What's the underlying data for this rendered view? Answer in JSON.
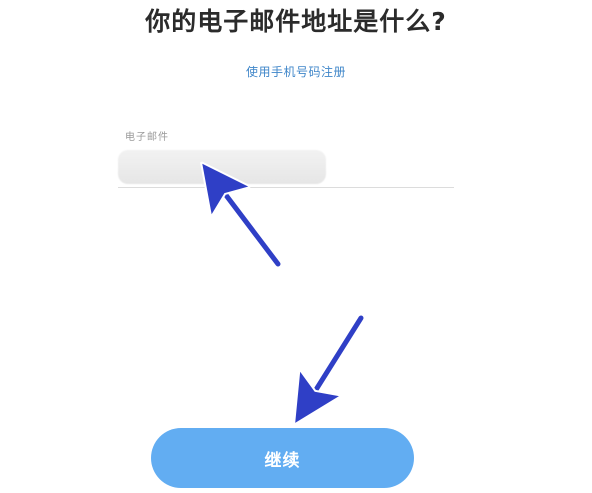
{
  "page": {
    "title": "你的电子邮件地址是什么?",
    "phone_signup_link": "使用手机号码注册"
  },
  "form": {
    "email_label": "电子邮件",
    "email_value": "",
    "continue_label": "继续"
  },
  "colors": {
    "link": "#3f86c9",
    "button": "#62adf2",
    "arrow": "#2f3fc6"
  },
  "icons": {
    "annotation": "arrow-icon"
  }
}
